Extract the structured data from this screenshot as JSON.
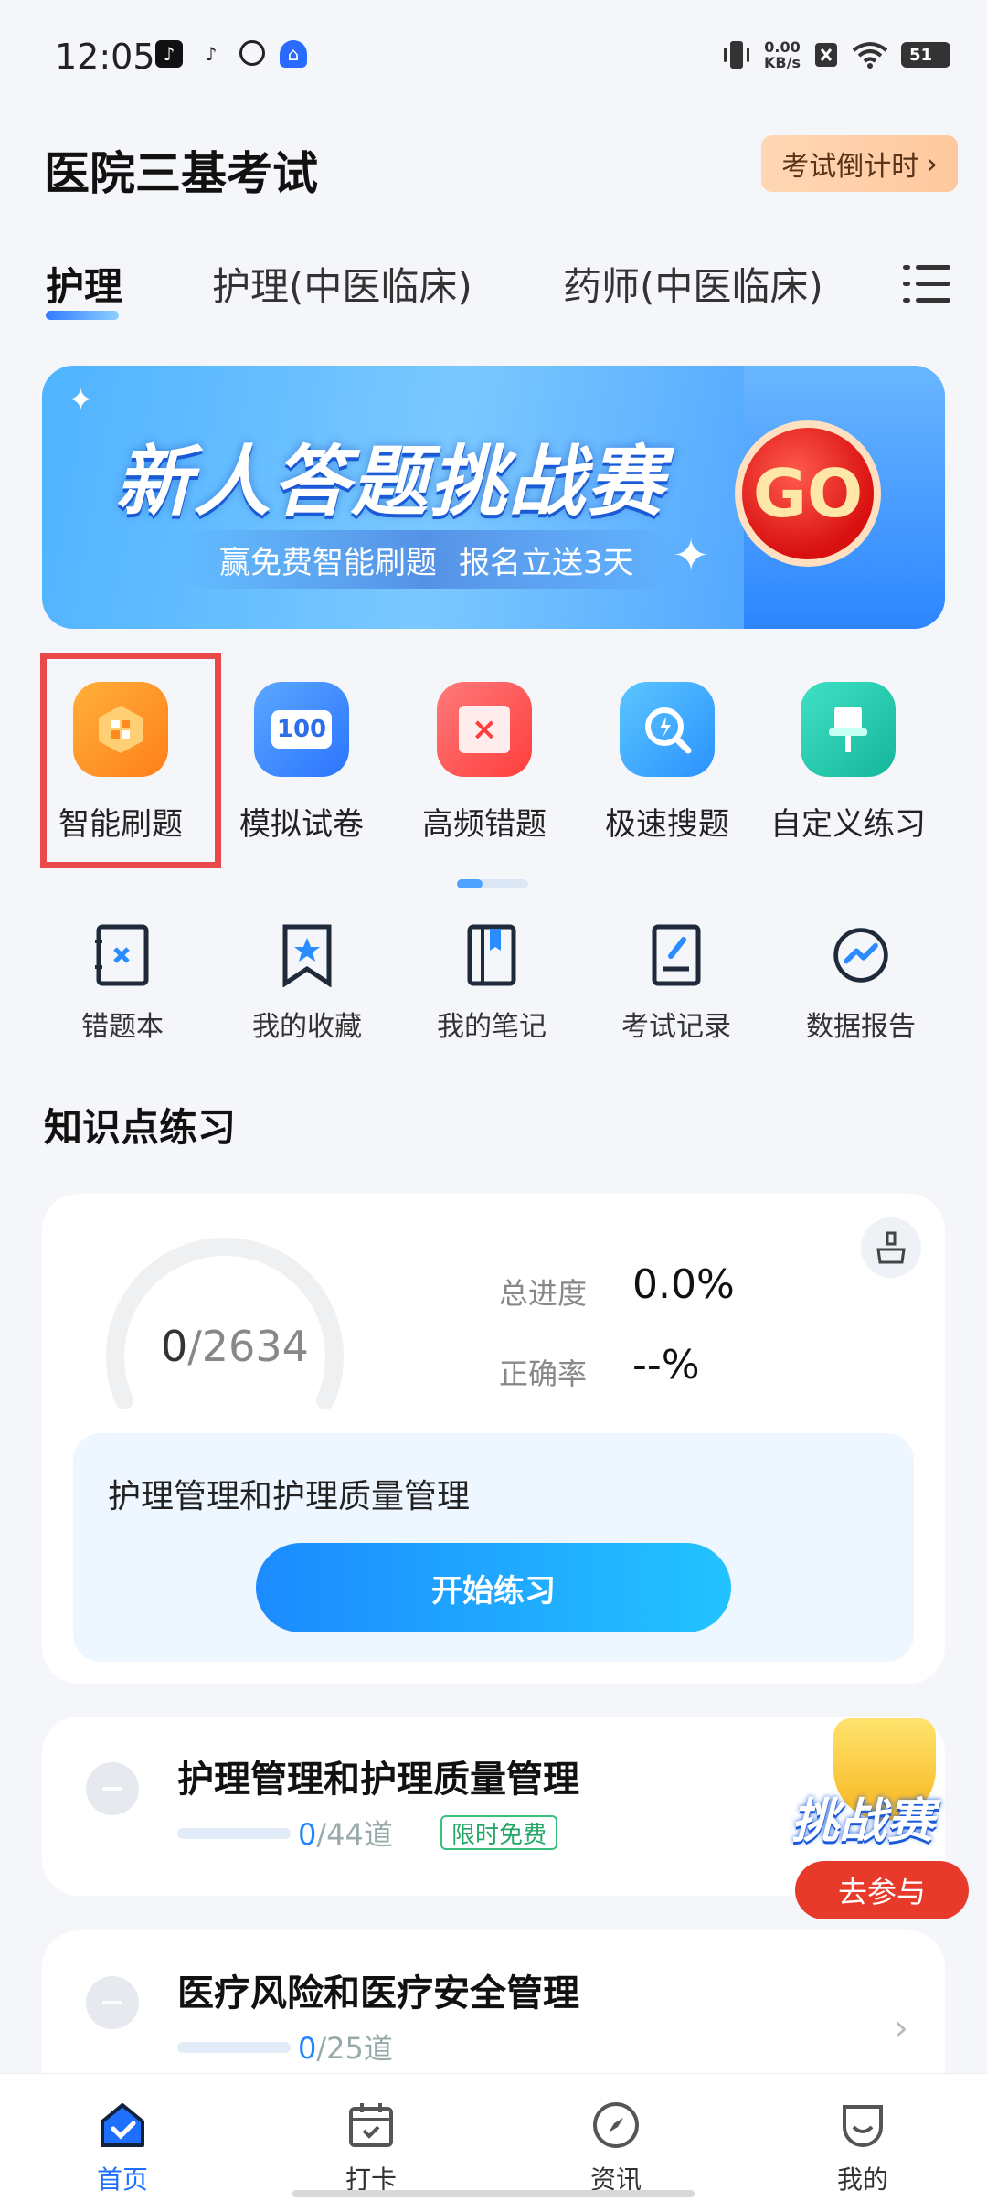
{
  "status_bar": {
    "time": "12:05",
    "net_speed_value": "0.00",
    "net_speed_unit": "KB/s",
    "battery": "51"
  },
  "header": {
    "title": "医院三基考试",
    "countdown_label": "考试倒计时"
  },
  "tabs": [
    {
      "label": "护理"
    },
    {
      "label": "护理(中医临床)"
    },
    {
      "label": "药师(中医临床)"
    }
  ],
  "banner": {
    "title": "新人答题挑战赛",
    "sub_left": "赢免费智能刷题",
    "sub_right": "报名立送3天",
    "go": "GO"
  },
  "tools": [
    {
      "label": "智能刷题",
      "icon": "smart-practice-icon",
      "color": "#ff9a1f"
    },
    {
      "label": "模拟试卷",
      "icon": "mock-exam-icon",
      "color": "#3b8dff"
    },
    {
      "label": "高频错题",
      "icon": "frequent-mistakes-icon",
      "color": "#ff5b5b"
    },
    {
      "label": "极速搜题",
      "icon": "quick-search-icon",
      "color": "#3aa8ff"
    },
    {
      "label": "自定义练习",
      "icon": "custom-practice-icon",
      "color": "#20c9b0"
    }
  ],
  "tools_icon_text": {
    "mock": "100"
  },
  "subtools": [
    {
      "label": "错题本",
      "icon": "mistake-book-icon"
    },
    {
      "label": "我的收藏",
      "icon": "favorites-icon"
    },
    {
      "label": "我的笔记",
      "icon": "notes-icon"
    },
    {
      "label": "考试记录",
      "icon": "exam-record-icon"
    },
    {
      "label": "数据报告",
      "icon": "data-report-icon"
    }
  ],
  "knowledge": {
    "section_title": "知识点练习",
    "done": "0",
    "total": "/2634",
    "progress_label": "总进度",
    "progress_value": "0.0%",
    "accuracy_label": "正确率",
    "accuracy_value": "--%",
    "current_topic": "护理管理和护理质量管理",
    "start_button": "开始练习"
  },
  "topics": [
    {
      "title": "护理管理和护理质量管理",
      "done": "0",
      "total": "/44道",
      "tag": "限时免费"
    },
    {
      "title": "医疗风险和医疗安全管理",
      "done": "0",
      "total": "/25道"
    }
  ],
  "float_challenge": {
    "title": "挑战赛",
    "button": "去参与"
  },
  "bottom_nav": [
    {
      "label": "首页",
      "icon": "home-icon"
    },
    {
      "label": "打卡",
      "icon": "calendar-check-icon"
    },
    {
      "label": "资讯",
      "icon": "compass-icon"
    },
    {
      "label": "我的",
      "icon": "profile-icon"
    }
  ],
  "colors": {
    "accent": "#1f86ff",
    "highlight_box": "#e84a4a",
    "free_tag": "#23a667"
  }
}
